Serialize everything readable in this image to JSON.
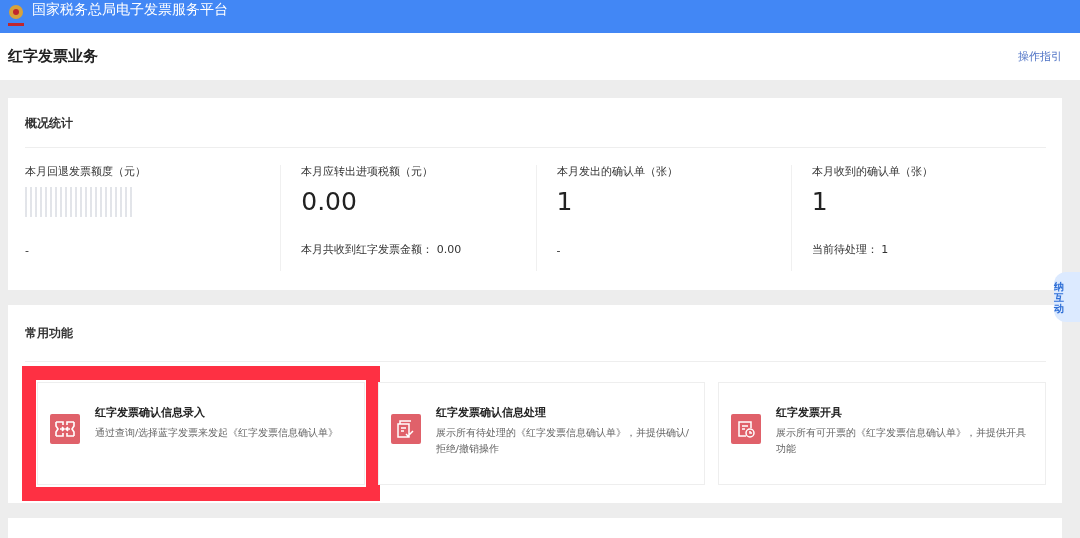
{
  "header": {
    "title": "国家税务总局电子发票服务平台"
  },
  "page": {
    "title": "红字发票业务",
    "guide_link": "操作指引"
  },
  "overview": {
    "title": "概况统计",
    "stats": [
      {
        "label": "本月回退发票额度（元）",
        "value_redacted": true,
        "footer": "-"
      },
      {
        "label": "本月应转出进项税额（元）",
        "value": "0.00",
        "footer": "本月共收到红字发票金额：  0.00"
      },
      {
        "label": "本月发出的确认单（张）",
        "value": "1",
        "footer": "-"
      },
      {
        "label": "本月收到的确认单（张）",
        "value": "1",
        "footer": "当前待处理：  1"
      }
    ]
  },
  "functions": {
    "title": "常用功能",
    "items": [
      {
        "kind": "entry",
        "title": "红字发票确认信息录入",
        "description": "通过查询/选择蓝字发票来发起《红字发票信息确认单》",
        "highlighted": true
      },
      {
        "kind": "process",
        "title": "红字发票确认信息处理",
        "description": "展示所有待处理的《红字发票信息确认单》，并提供确认/拒绝/撤销操作",
        "highlighted": false
      },
      {
        "kind": "issue",
        "title": "红字发票开具",
        "description": "展示所有可开票的《红字发票信息确认单》，并提供开具功能",
        "highlighted": false
      }
    ]
  },
  "assistant_widget": {
    "label": "纳互动"
  }
}
